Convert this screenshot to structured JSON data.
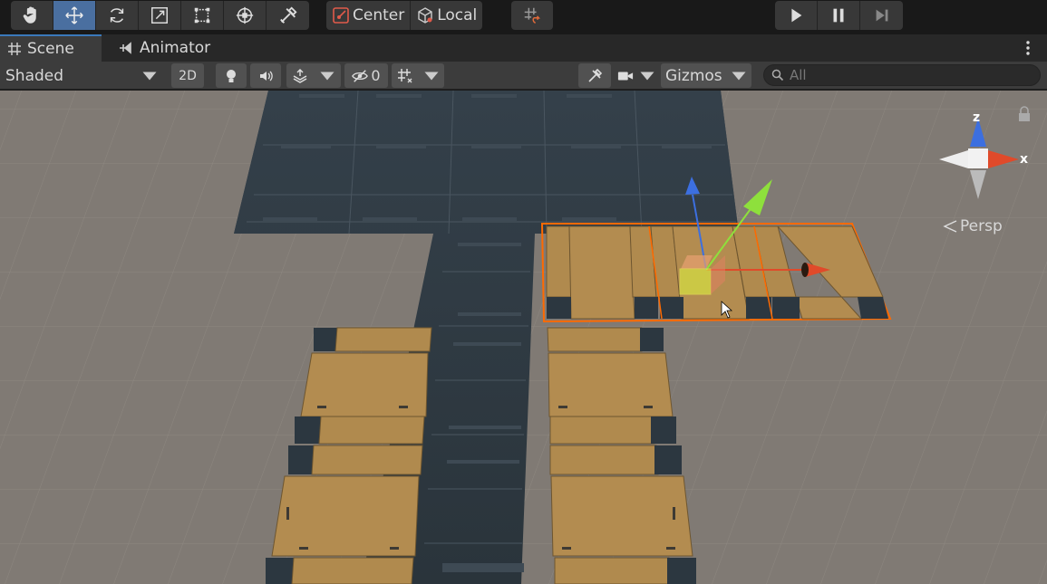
{
  "toolbar": {
    "tools": [
      {
        "name": "hand-icon"
      },
      {
        "name": "move-icon"
      },
      {
        "name": "rotate-icon"
      },
      {
        "name": "scale-icon"
      },
      {
        "name": "rect-icon"
      },
      {
        "name": "transform-icon"
      },
      {
        "name": "custom-tools-icon"
      }
    ],
    "active_tool": "move-icon",
    "pivot_label": "Center",
    "rotation_label": "Local",
    "snap_icon": "grid-snap-icon"
  },
  "playback": {
    "play_icon": "play-icon",
    "pause_icon": "pause-icon",
    "step_icon": "step-icon"
  },
  "tabs": [
    {
      "label": "Scene",
      "icon": "scene-grid-icon",
      "selected": true
    },
    {
      "label": "Animator",
      "icon": "animator-icon",
      "selected": false
    }
  ],
  "scene_bar": {
    "draw_mode": "Shaded",
    "mode_2d": "2D",
    "hidden_count": "0",
    "gizmos_label": "Gizmos",
    "search_placeholder": "All"
  },
  "view_gizmo": {
    "z_label": "z",
    "x_label": "x",
    "projection_label": "Persp"
  },
  "colors": {
    "accent_blue": "#4a6fa0",
    "selection_orange": "#ff6a00",
    "axis_x": "#e04a2a",
    "axis_y": "#8ee03c",
    "axis_z": "#3c6fe0",
    "ground": "#807a74",
    "wood": "#b08a4e",
    "metal": "#2f3a42"
  }
}
